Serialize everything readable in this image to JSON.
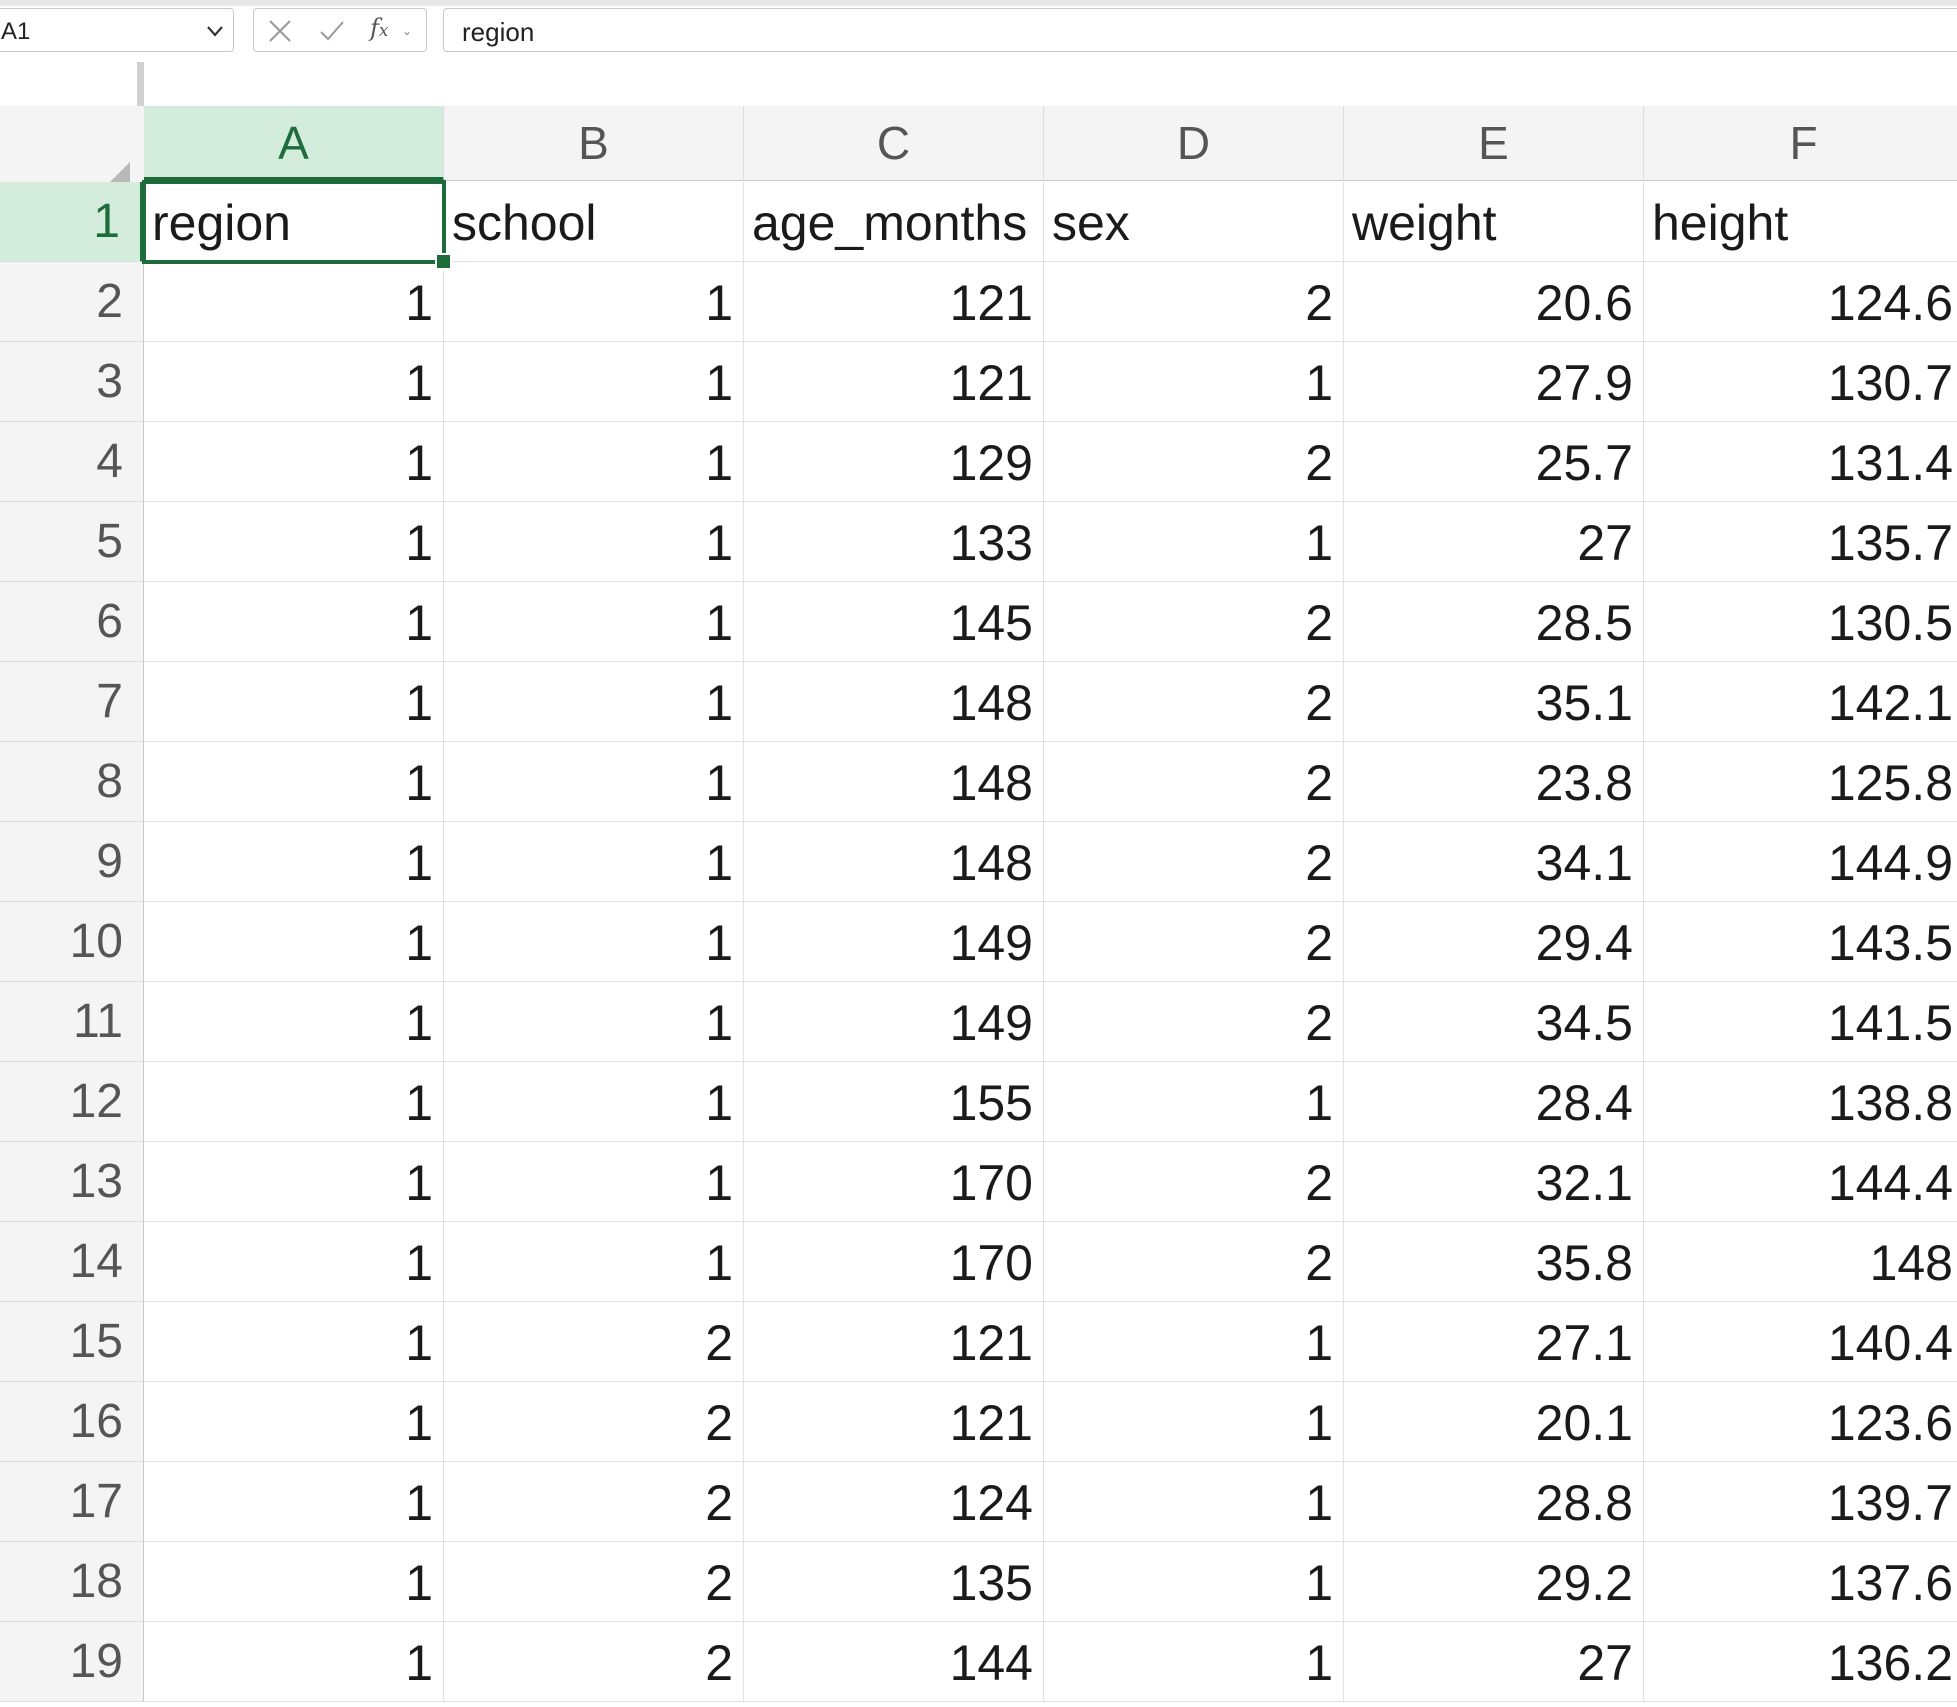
{
  "name_box": {
    "value": "A1"
  },
  "formula_bar": {
    "value": "region",
    "insert_function_label": "f",
    "insert_function_sub": "x"
  },
  "columns": [
    "A",
    "B",
    "C",
    "D",
    "E",
    "F"
  ],
  "header_row": [
    "region",
    "school",
    "age_months",
    "sex",
    "weight",
    "height"
  ],
  "rows": [
    [
      "1",
      "1",
      "121",
      "2",
      "20.6",
      "124.6"
    ],
    [
      "1",
      "1",
      "121",
      "1",
      "27.9",
      "130.7"
    ],
    [
      "1",
      "1",
      "129",
      "2",
      "25.7",
      "131.4"
    ],
    [
      "1",
      "1",
      "133",
      "1",
      "27",
      "135.7"
    ],
    [
      "1",
      "1",
      "145",
      "2",
      "28.5",
      "130.5"
    ],
    [
      "1",
      "1",
      "148",
      "2",
      "35.1",
      "142.1"
    ],
    [
      "1",
      "1",
      "148",
      "2",
      "23.8",
      "125.8"
    ],
    [
      "1",
      "1",
      "148",
      "2",
      "34.1",
      "144.9"
    ],
    [
      "1",
      "1",
      "149",
      "2",
      "29.4",
      "143.5"
    ],
    [
      "1",
      "1",
      "149",
      "2",
      "34.5",
      "141.5"
    ],
    [
      "1",
      "1",
      "155",
      "1",
      "28.4",
      "138.8"
    ],
    [
      "1",
      "1",
      "170",
      "2",
      "32.1",
      "144.4"
    ],
    [
      "1",
      "1",
      "170",
      "2",
      "35.8",
      "148"
    ],
    [
      "1",
      "2",
      "121",
      "1",
      "27.1",
      "140.4"
    ],
    [
      "1",
      "2",
      "121",
      "1",
      "20.1",
      "123.6"
    ],
    [
      "1",
      "2",
      "124",
      "1",
      "28.8",
      "139.7"
    ],
    [
      "1",
      "2",
      "135",
      "1",
      "29.2",
      "137.6"
    ],
    [
      "1",
      "2",
      "144",
      "1",
      "27",
      "136.2"
    ]
  ],
  "row_numbers": [
    "1",
    "2",
    "3",
    "4",
    "5",
    "6",
    "7",
    "8",
    "9",
    "10",
    "11",
    "12",
    "13",
    "14",
    "15",
    "16",
    "17",
    "18",
    "19"
  ],
  "selection": {
    "column": "A",
    "row": "1"
  },
  "colors": {
    "accent": "#1e6b3c",
    "selected_header_bg": "#d3ecdc",
    "header_bg": "#f4f4f4",
    "grid_line": "#e1e1e1"
  },
  "icons": {
    "name_box_dropdown": "chevron-down-icon",
    "cancel": "cancel-x-icon",
    "enter": "checkmark-icon",
    "insert_function": "fx-icon",
    "select_all": "select-all-triangle-icon"
  }
}
